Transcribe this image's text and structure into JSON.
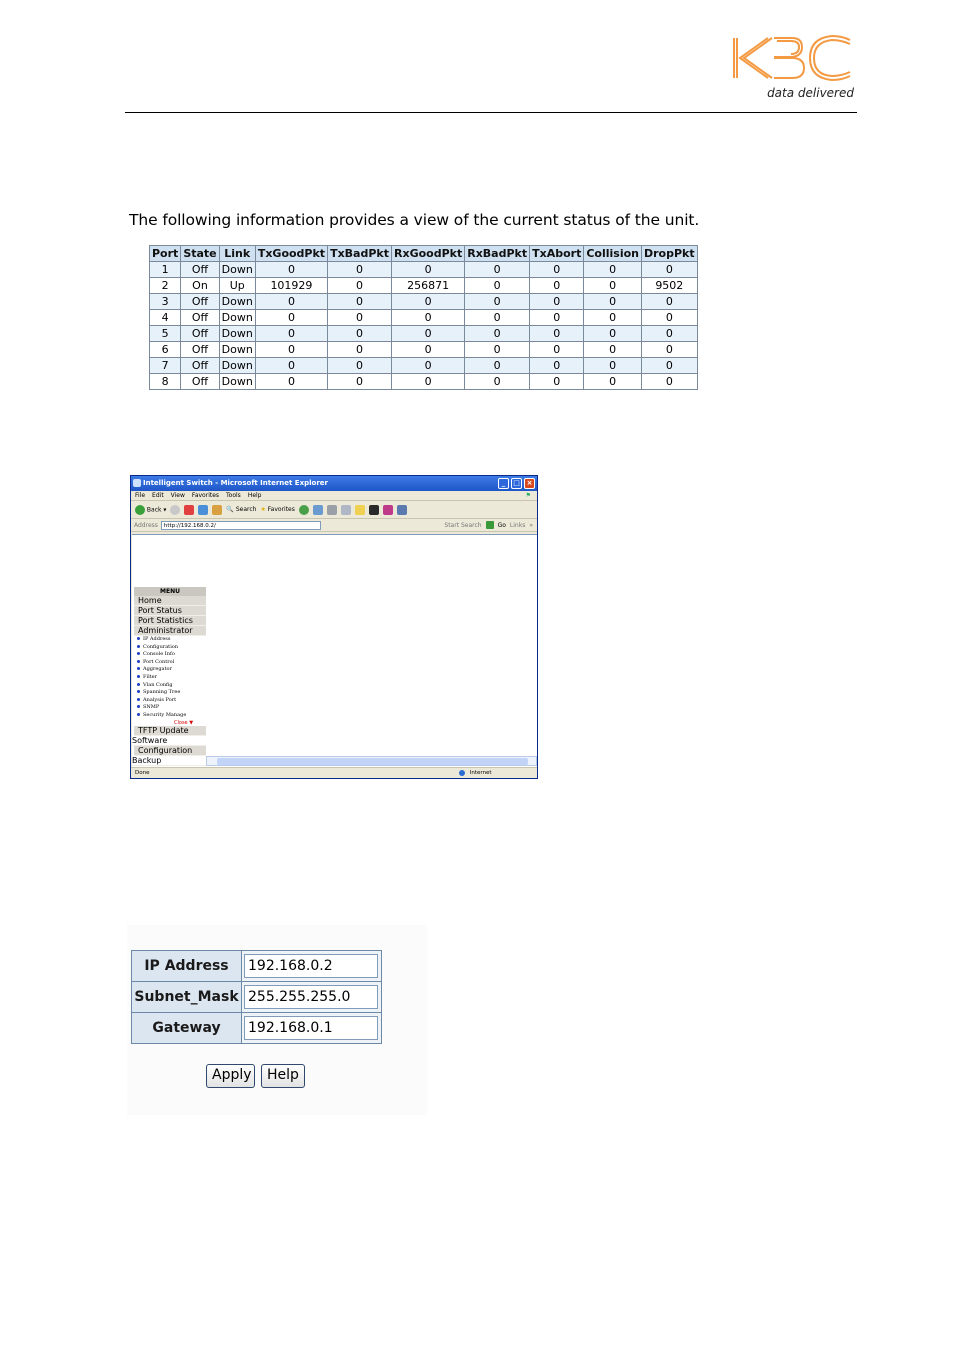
{
  "header": {
    "logo_text": "KBC",
    "tagline": "data delivered",
    "logo_color": "#f39a43"
  },
  "port_status": {
    "caption": "The following information provides a view of the current status of the unit.",
    "columns": [
      "Port",
      "State",
      "Link",
      "TxGoodPkt",
      "TxBadPkt",
      "RxGoodPkt",
      "RxBadPkt",
      "TxAbort",
      "Collision",
      "DropPkt"
    ],
    "rows": [
      [
        "1",
        "Off",
        "Down",
        "0",
        "0",
        "0",
        "0",
        "0",
        "0",
        "0"
      ],
      [
        "2",
        "On",
        "Up",
        "101929",
        "0",
        "256871",
        "0",
        "0",
        "0",
        "9502"
      ],
      [
        "3",
        "Off",
        "Down",
        "0",
        "0",
        "0",
        "0",
        "0",
        "0",
        "0"
      ],
      [
        "4",
        "Off",
        "Down",
        "0",
        "0",
        "0",
        "0",
        "0",
        "0",
        "0"
      ],
      [
        "5",
        "Off",
        "Down",
        "0",
        "0",
        "0",
        "0",
        "0",
        "0",
        "0"
      ],
      [
        "6",
        "Off",
        "Down",
        "0",
        "0",
        "0",
        "0",
        "0",
        "0",
        "0"
      ],
      [
        "7",
        "Off",
        "Down",
        "0",
        "0",
        "0",
        "0",
        "0",
        "0",
        "0"
      ],
      [
        "8",
        "Off",
        "Down",
        "0",
        "0",
        "0",
        "0",
        "0",
        "0",
        "0"
      ]
    ]
  },
  "browser": {
    "title": "Intelligent Switch - Microsoft Internet Explorer",
    "menus": [
      "File",
      "Edit",
      "View",
      "Favorites",
      "Tools",
      "Help"
    ],
    "toolbar": {
      "back": "Back",
      "search": "Search",
      "favorites": "Favorites"
    },
    "address_label": "Address",
    "address_url": "http://192.168.0.2/",
    "start_search": "Start Search",
    "go": "Go",
    "links": "Links",
    "status_text": "Done",
    "zone_text": "Internet",
    "side_menu": {
      "header": "MENU",
      "items": [
        "Home",
        "Port Status",
        "Port Statistics",
        "Administrator"
      ],
      "sub_items": [
        "IP Address",
        "Configuration",
        "Console Info",
        "Port Control",
        "Aggregator",
        "Filter",
        "Vlan Config",
        "Spanning Tree",
        "Analysis Port",
        "SNMP",
        "Security Manage"
      ],
      "close": "Close",
      "tail_items": [
        "TFTP Update",
        "Software",
        "Configuration",
        "Backup"
      ]
    }
  },
  "ip_form": {
    "fields": [
      {
        "label": "IP Address",
        "value": "192.168.0.2"
      },
      {
        "label": "Subnet_Mask",
        "value": "255.255.255.0"
      },
      {
        "label": "Gateway",
        "value": "192.168.0.1"
      }
    ],
    "apply_label": "Apply",
    "help_label": "Help"
  }
}
